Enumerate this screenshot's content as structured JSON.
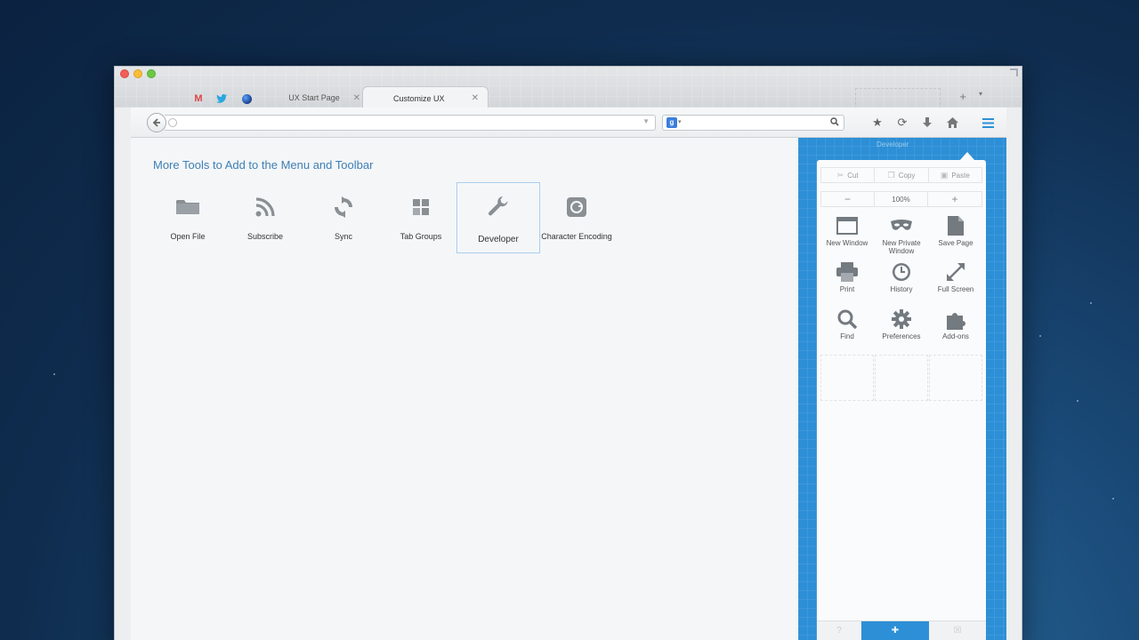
{
  "browser": {
    "tabs": [
      {
        "label": "UX Start Page",
        "active": false
      },
      {
        "label": "Customize UX",
        "active": true
      }
    ],
    "new_tab_symbol": "+",
    "tab_list_symbol": "▾",
    "pinned_tabs": [
      "gmail-icon",
      "twitter-icon",
      "firefox-icon"
    ],
    "url": {
      "value": "",
      "placeholder": ""
    },
    "search": {
      "value": "",
      "engine": "google-icon",
      "engine_letter": "g"
    },
    "toolbar_icons": [
      "bookmark-star-icon",
      "sync-icon",
      "download-icon",
      "home-icon",
      "menu-icon"
    ],
    "accent": "#2d8fd6"
  },
  "customize": {
    "heading": "More Tools to Add to the Menu and Toolbar",
    "tools": [
      {
        "label": "Open File",
        "icon": "folder-icon"
      },
      {
        "label": "Subscribe",
        "icon": "rss-icon"
      },
      {
        "label": "Sync",
        "icon": "sync-icon"
      },
      {
        "label": "Tab Groups",
        "icon": "tab-groups-icon"
      },
      {
        "label": "Developer",
        "icon": "wrench-icon",
        "selected": true
      },
      {
        "label": "Character Encoding",
        "icon": "character-encoding-icon"
      }
    ]
  },
  "menu_panel": {
    "ghost_label": "Developer",
    "edit": {
      "cut": "Cut",
      "copy": "Copy",
      "paste": "Paste"
    },
    "zoom": {
      "out": "−",
      "value": "100%",
      "in": "+"
    },
    "items": [
      {
        "label": "New Window",
        "icon": "new-window-icon"
      },
      {
        "label": "New Private Window",
        "icon": "private-mask-icon"
      },
      {
        "label": "Save Page",
        "icon": "save-page-icon"
      },
      {
        "label": "Print",
        "icon": "print-icon"
      },
      {
        "label": "History",
        "icon": "history-clock-icon"
      },
      {
        "label": "Full Screen",
        "icon": "fullscreen-icon"
      },
      {
        "label": "Find",
        "icon": "magnifier-icon"
      },
      {
        "label": "Preferences",
        "icon": "gear-icon"
      },
      {
        "label": "Add-ons",
        "icon": "puzzle-icon"
      }
    ],
    "footer": [
      "help-icon",
      "customize-icon",
      "quit-icon"
    ]
  }
}
